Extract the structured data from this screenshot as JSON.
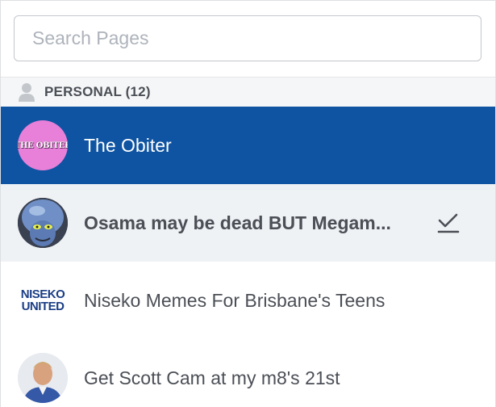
{
  "search": {
    "placeholder": "Search Pages"
  },
  "section": {
    "icon": "person-icon",
    "label": "PERSONAL (12)"
  },
  "pages": [
    {
      "name": "The Obiter",
      "avatar_text": "THE OBITER",
      "state": "selected",
      "checked": false
    },
    {
      "name": "Osama may be dead BUT Megam...",
      "state": "hover",
      "checked": true,
      "check_icon": "checkmark-icon"
    },
    {
      "name": "Niseko Memes For Brisbane's Teens",
      "avatar_text_line1": "NISEKO",
      "avatar_text_line2": "UNITED",
      "state": "normal",
      "checked": false
    },
    {
      "name": "Get Scott Cam at my m8's 21st",
      "state": "normal",
      "checked": false
    }
  ],
  "colors": {
    "selected_bg": "#0e54a2",
    "hover_bg": "#eff2f5",
    "section_bg": "#f5f6f7",
    "text": "#4b4f56"
  }
}
